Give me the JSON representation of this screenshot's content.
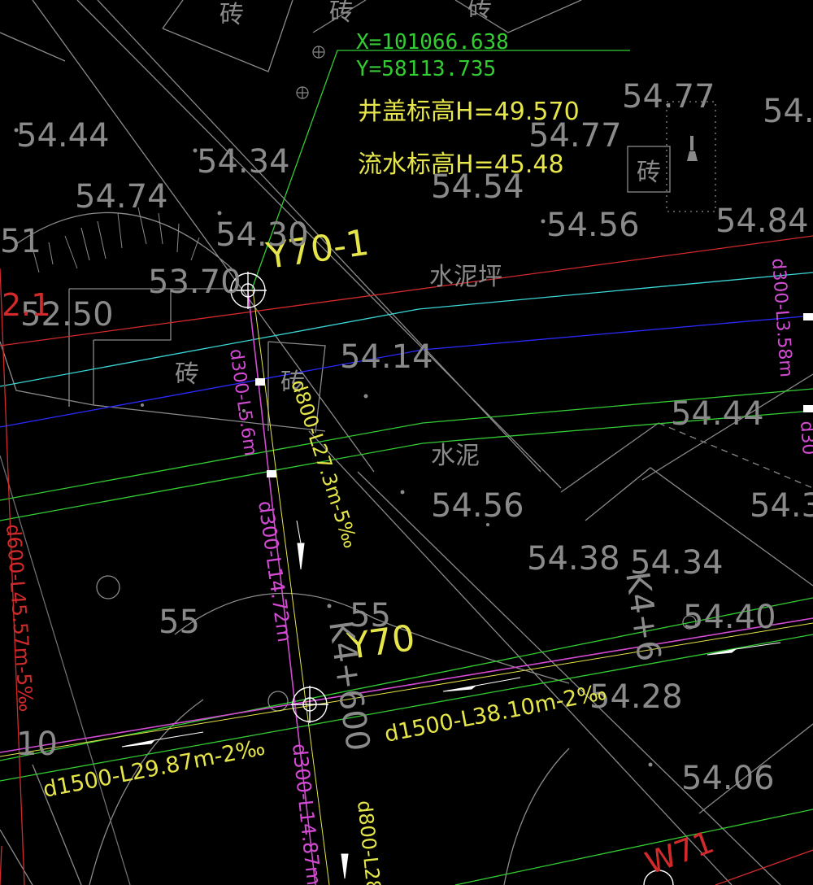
{
  "coordinates": {
    "x": "X=101066.638",
    "y": "Y=58113.735"
  },
  "manhole_info": {
    "cover_elevation": "井盖标高H=49.570",
    "invert_elevation": "流水标高H=45.48"
  },
  "manholes": {
    "upper": "Y70-1",
    "lower": "Y70"
  },
  "surface_labels": {
    "cement_slope": "水泥坪",
    "cement": "水泥",
    "brick": "砖"
  },
  "elevations": {
    "e1": "54.44",
    "e2": "54.74",
    "e3": "54.34",
    "e4": "54.30",
    "e5": "53.70",
    "e6": "52.50",
    "e7": "54.77",
    "e8": "54.77",
    "e9": "54.54",
    "e10": "54.56",
    "e11": "54.84",
    "e12": "54.14",
    "e13": "54.44",
    "e14": "54.56",
    "e15": "54.38",
    "e16": "54.34",
    "e17": "54.40",
    "e18": "54.28",
    "e19": "54.06",
    "e20": "55",
    "e21": "55",
    "e22": "54.3",
    "e23": "54.",
    "e24": "51",
    "e25": "10"
  },
  "pipes": {
    "p1": "d300-L5.6m",
    "p2": "d800-L27.3m-5‰",
    "p3": "d300-L14.72m",
    "p4": "d600-L45.57m-5‰",
    "p5": "d1500-L38.10m-2‰",
    "p6": "d1500-L29.87m-2‰",
    "p7": "d300-L14.87m",
    "p8": "d800-L28",
    "p9": "d300-L3.58m",
    "p10": "d30"
  },
  "stations": {
    "s1": "K4+600",
    "s2": "K4+6"
  },
  "misc": {
    "red_label": "2.1",
    "w_label": "W71"
  },
  "colors": {
    "background": "#000000",
    "gray": "#8a8a8a",
    "yellow": "#e6e64a",
    "green": "#33cc33",
    "magenta": "#d24bd2",
    "red": "#d22a2a",
    "cyan": "#3ad6d6",
    "blue": "#2a2aff",
    "white": "#ffffff"
  }
}
